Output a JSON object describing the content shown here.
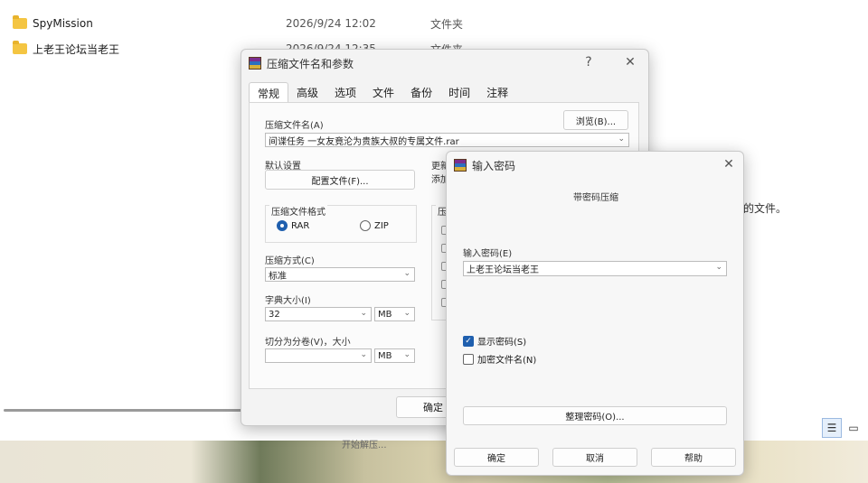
{
  "explorer": {
    "files": [
      {
        "name": "SpyMission",
        "date": "2026/9/24 12:02",
        "type": "文件夹"
      },
      {
        "name": "上老王论坛当老王",
        "date": "2026/9/24 12:35",
        "type": "文件夹"
      }
    ],
    "snippet": "的文件。",
    "taskbar_text": "开始解压...",
    "view_details_glyph": "☰",
    "view_tiles_glyph": "▭"
  },
  "archive_dialog": {
    "title": "压缩文件名和参数",
    "help_glyph": "?",
    "close_glyph": "✕",
    "tabs": [
      "常规",
      "高级",
      "选项",
      "文件",
      "备份",
      "时间",
      "注释"
    ],
    "active_tab": "常规",
    "archive_name_label": "压缩文件名(A)",
    "browse_button": "浏览(B)...",
    "archive_name_value": "间谍任务 一女友竟沦为贵族大叔的专属文件.rar",
    "default_settings_label": "默认设置",
    "profiles_button": "配置文件(F)...",
    "update_label": "更新",
    "update_value": "添加",
    "format_label": "压缩文件格式",
    "format_options": [
      "RAR",
      "ZIP"
    ],
    "format_selected": "RAR",
    "method_label": "压缩方式(C)",
    "method_value": "标准",
    "dict_label": "字典大小(I)",
    "dict_value": "32",
    "dict_unit": "MB",
    "split_label": "切分为分卷(V)，大小",
    "split_value": "",
    "split_unit": "MB",
    "options_label": "压",
    "ok_button": "确定"
  },
  "password_dialog": {
    "title": "输入密码",
    "close_glyph": "✕",
    "subtitle": "带密码压缩",
    "password_label": "输入密码(E)",
    "password_value": "上老王论坛当老王",
    "show_password_label": "显示密码(S)",
    "show_password_checked": true,
    "encrypt_names_label": "加密文件名(N)",
    "encrypt_names_checked": false,
    "organize_button": "整理密码(O)...",
    "ok_button": "确定",
    "cancel_button": "取消",
    "help_button": "帮助",
    "check_glyph": "✓",
    "chevron_glyph": "⌄"
  },
  "colors": {
    "accent": "#1f5fae",
    "folder": "#f4c542"
  }
}
